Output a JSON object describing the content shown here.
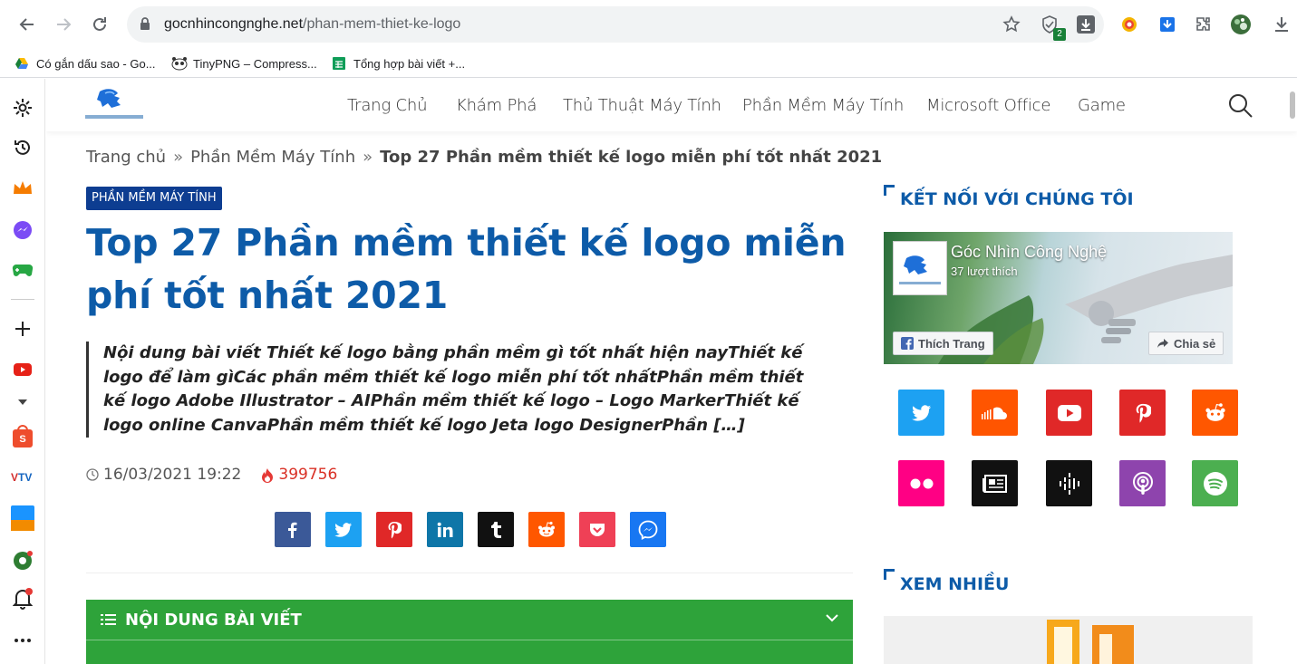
{
  "browser": {
    "url_domain": "gocnhincongnghe.net",
    "url_path": "/phan-mem-thiet-ke-logo",
    "badge_count": "2",
    "bookmarks": [
      {
        "label": "Có gắn dấu sao - Go..."
      },
      {
        "label": "TinyPNG – Compress..."
      },
      {
        "label": "Tổng hợp bài viết +..."
      }
    ]
  },
  "site": {
    "menu": [
      "Trang Chủ",
      "Khám Phá",
      "Thủ Thuật Máy Tính",
      "Phần Mềm Máy Tính",
      "Microsoft Office",
      "Game"
    ]
  },
  "breadcrumb": {
    "home": "Trang chủ",
    "sep": "»",
    "category": "Phần Mềm Máy Tính",
    "current": "Top 27 Phần mềm thiết kế logo miễn phí tốt nhất 2021"
  },
  "article": {
    "category_badge": "PHẦN MỀM MÁY TÍNH",
    "title": "Top 27 Phần mềm thiết kế logo miễn phí tốt nhất 2021",
    "excerpt": "Nội dung bài viết Thiết kế logo bằng phần mềm gì tốt nhất hiện nayThiết kế logo để làm gìCác phần mềm thiết kế logo miễn phí tốt nhấtPhần mềm thiết kế logo Adobe Illustrator – AIPhần mềm thiết kế logo – Logo MarkerThiết kế logo online CanvaPhần mềm thiết kế logo Jeta logo DesignerPhần […]",
    "date": "16/03/2021 19:22",
    "views": "399756",
    "toc_title": "NỘI DUNG BÀI VIẾT"
  },
  "share_buttons": [
    {
      "name": "facebook",
      "color": "#3b5998"
    },
    {
      "name": "twitter",
      "color": "#1da1f2"
    },
    {
      "name": "pinterest",
      "color": "#e02828"
    },
    {
      "name": "linkedin",
      "color": "#0e76a8"
    },
    {
      "name": "tumblr",
      "color": "#111111"
    },
    {
      "name": "reddit",
      "color": "#ff5700"
    },
    {
      "name": "pocket",
      "color": "#ef4056"
    },
    {
      "name": "messenger",
      "color": "#1877f2"
    }
  ],
  "sidebar_widget": {
    "connect_title": "KẾT NỐI VỚI CHÚNG TÔI",
    "fb_page_name": "Góc Nhìn Công Nghệ",
    "fb_likes": "37 lượt thích",
    "fb_like_button": "Thích Trang",
    "fb_share_button": "Chia sẻ",
    "most_viewed_title": "XEM NHIỀU"
  },
  "social_icons": [
    {
      "name": "twitter",
      "color": "#1da1f2"
    },
    {
      "name": "soundcloud",
      "color": "#ff5500"
    },
    {
      "name": "youtube",
      "color": "#e02828"
    },
    {
      "name": "pinterest",
      "color": "#e02828"
    },
    {
      "name": "reddit",
      "color": "#ff5700"
    },
    {
      "name": "flickr",
      "color": "#ff0084"
    },
    {
      "name": "news",
      "color": "#111111"
    },
    {
      "name": "podcast-audio",
      "color": "#111111"
    },
    {
      "name": "apple-podcasts",
      "color": "#8e44ad"
    },
    {
      "name": "spotify",
      "color": "#4caf50"
    }
  ]
}
